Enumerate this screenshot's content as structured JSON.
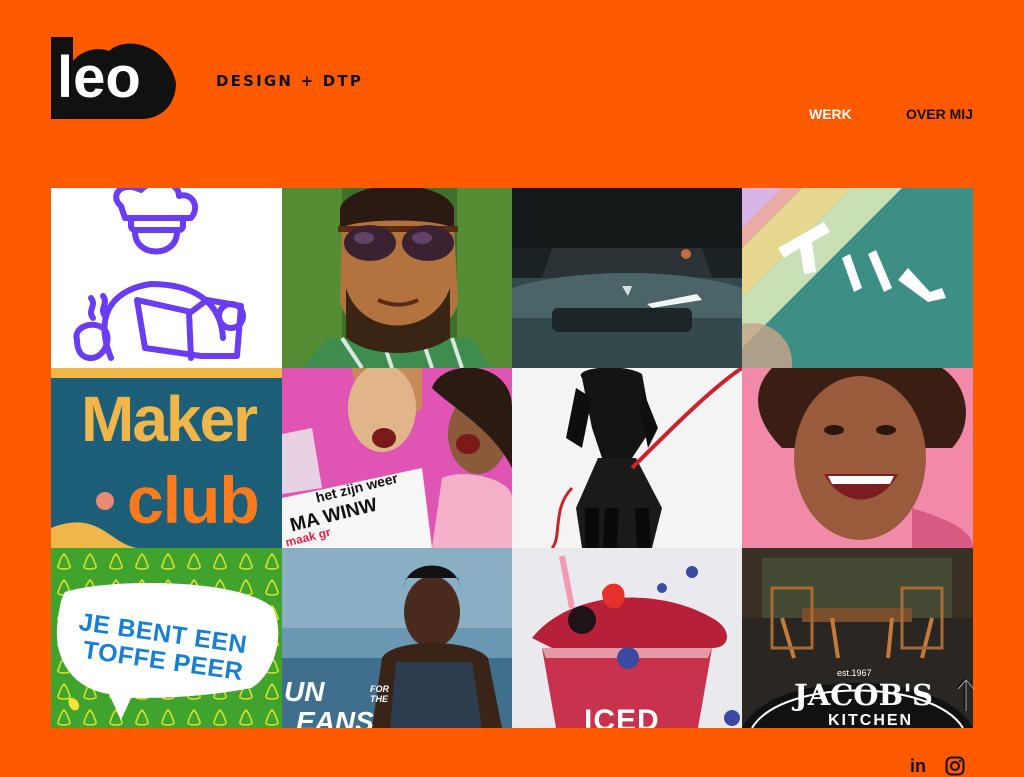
{
  "header": {
    "logo_text": "leo",
    "tagline": "DESIGN + DTP"
  },
  "nav": {
    "items": [
      {
        "label": "WERK",
        "active": true
      },
      {
        "label": "OVER MIJ",
        "active": false
      }
    ]
  },
  "portfolio": {
    "tiles": [
      {
        "name": "reading-boy-illustration"
      },
      {
        "name": "man-sunglasses-photo"
      },
      {
        "name": "polestar-car-photo"
      },
      {
        "name": "till-logo-stripes"
      },
      {
        "name": "maker-club-poster",
        "text_line1": "Maker",
        "text_line2": "club"
      },
      {
        "name": "women-shouting-poster",
        "text_line1": "het zijn weer",
        "text_line2": "MA WINW",
        "text_line3": "maak gr"
      },
      {
        "name": "black-dog-leash-photo"
      },
      {
        "name": "smiling-woman-photo"
      },
      {
        "name": "toffe-peer-poster",
        "text_line1": "JE BENT EEN",
        "text_line2": "TOFFE PEER"
      },
      {
        "name": "runner-oceans-photo",
        "text_line1": "UN",
        "text_line2": "FOR THE",
        "text_line3": "EANS"
      },
      {
        "name": "iced-berry-drink-photo",
        "text_line1": "ICED"
      },
      {
        "name": "jacobs-kitchen-photo",
        "text_line1": "est.1967",
        "text_line2": "JACOB'S",
        "text_line3": "KITCHEN"
      }
    ]
  },
  "footer": {
    "linkedin": "in",
    "instagram_icon": "instagram-icon"
  },
  "colors": {
    "background": "#ff5a00",
    "nav_active": "#ffffff",
    "text": "#111111"
  }
}
